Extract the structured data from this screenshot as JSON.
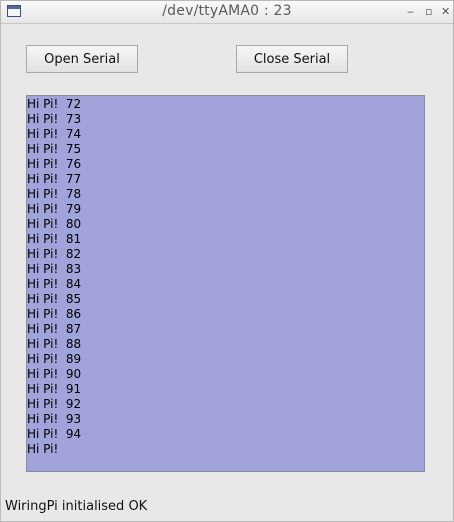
{
  "window": {
    "title": "/dev/ttyAMA0 : 23",
    "controls": {
      "minimize": "‒",
      "maximize": "▫",
      "close": "✕"
    }
  },
  "toolbar": {
    "open_label": "Open Serial",
    "close_label": "Close Serial"
  },
  "terminal": {
    "lines": [
      "Hi Pi!  72",
      "Hi Pi!  73",
      "Hi Pi!  74",
      "Hi Pi!  75",
      "Hi Pi!  76",
      "Hi Pi!  77",
      "Hi Pi!  78",
      "Hi Pi!  79",
      "Hi Pi!  80",
      "Hi Pi!  81",
      "Hi Pi!  82",
      "Hi Pi!  83",
      "Hi Pi!  84",
      "Hi Pi!  85",
      "Hi Pi!  86",
      "Hi Pi!  87",
      "Hi Pi!  88",
      "Hi Pi!  89",
      "Hi Pi!  90",
      "Hi Pi!  91",
      "Hi Pi!  92",
      "Hi Pi!  93",
      "Hi Pi!  94",
      "Hi Pi!"
    ],
    "background": "#a0a4da"
  },
  "status": {
    "text": "WiringPi initialised OK"
  }
}
